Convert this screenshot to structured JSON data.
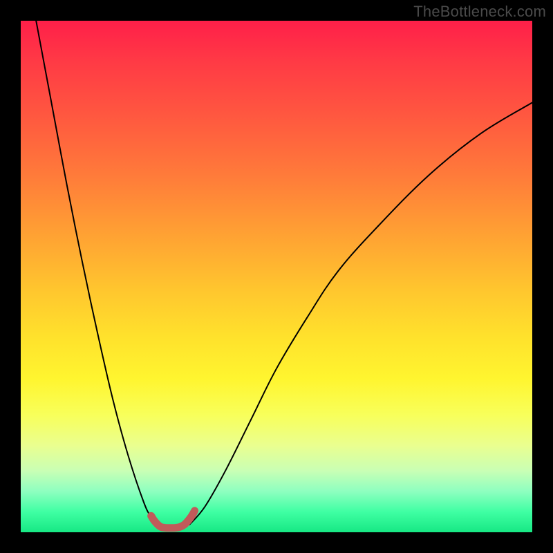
{
  "watermark": "TheBottleneck.com",
  "colors": {
    "curve_stroke": "#000000",
    "marker_stroke": "#c05a5a",
    "background_frame": "#000000"
  },
  "chart_data": {
    "type": "line",
    "title": "",
    "xlabel": "",
    "ylabel": "",
    "xlim": [
      0,
      100
    ],
    "ylim": [
      0,
      100
    ],
    "grid": false,
    "legend": false,
    "series": [
      {
        "name": "left-branch",
        "x": [
          3,
          6,
          9,
          12,
          15,
          18,
          21,
          24,
          25.5,
          27
        ],
        "y": [
          100,
          84,
          68,
          53,
          39,
          26,
          15,
          6,
          3,
          1.5
        ]
      },
      {
        "name": "right-branch",
        "x": [
          33,
          36,
          40,
          45,
          50,
          56,
          62,
          70,
          80,
          90,
          100
        ],
        "y": [
          1.5,
          5,
          12,
          22,
          32,
          42,
          51,
          60,
          70,
          78,
          84
        ]
      },
      {
        "name": "valley-marker",
        "x": [
          25.5,
          26,
          26.5,
          27,
          27.5,
          28,
          28.5,
          29,
          29.5,
          30,
          30.5,
          31,
          31.5,
          32,
          32.5,
          33,
          33.5,
          34
        ],
        "y": [
          3.2,
          2.4,
          1.8,
          1.3,
          1.0,
          0.9,
          0.85,
          0.85,
          0.85,
          0.85,
          0.9,
          1.0,
          1.2,
          1.5,
          2.0,
          2.6,
          3.3,
          4.2
        ]
      }
    ],
    "annotations": []
  }
}
